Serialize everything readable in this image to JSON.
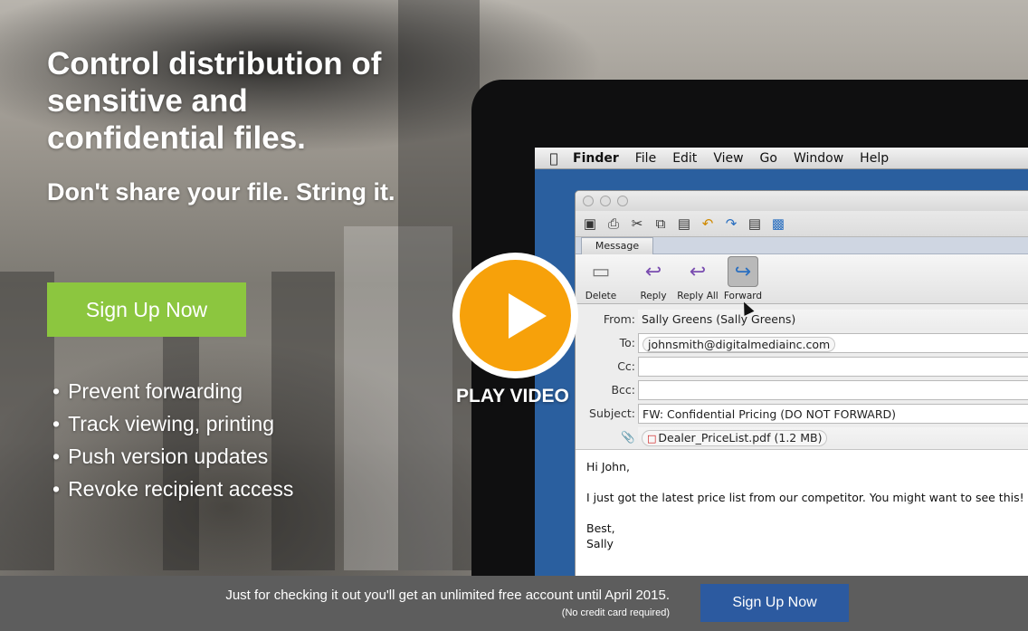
{
  "hero": {
    "headline": "Control distribution of sensitive and confidential files.",
    "subhead": "Don't share your file. String it.",
    "signup_label": "Sign Up Now",
    "features": [
      "Prevent forwarding",
      "Track viewing, printing",
      "Push version updates",
      "Revoke recipient access"
    ]
  },
  "video": {
    "label": "PLAY VIDEO"
  },
  "mac_menu": {
    "apple": "",
    "items": [
      "Finder",
      "File",
      "Edit",
      "View",
      "Go",
      "Window",
      "Help"
    ]
  },
  "mail": {
    "tab": "Message",
    "ribbon": [
      {
        "label": "Delete",
        "icon": "trash-icon"
      },
      {
        "label": "Reply",
        "icon": "reply-icon"
      },
      {
        "label": "Reply All",
        "icon": "reply-all-icon"
      },
      {
        "label": "Forward",
        "icon": "forward-icon"
      }
    ],
    "from_label": "From:",
    "from_value": "Sally Greens (Sally Greens)",
    "to_label": "To:",
    "to_value": "johnsmith@digitalmediainc.com",
    "cc_label": "Cc:",
    "cc_value": "",
    "bcc_label": "Bcc:",
    "bcc_value": "",
    "subject_label": "Subject:",
    "subject_value": "FW: Confidential Pricing (DO NOT FORWARD)",
    "attachment": "Dealer_PriceList.pdf (1.2 MB)",
    "body": {
      "greeting": "Hi John,",
      "line": "I just got the latest price list from our competitor. You might want to see this!",
      "closing": "Best,",
      "signature": "Sally"
    }
  },
  "bottom": {
    "offer": "Just for checking it out you'll get an unlimited free account until April 2015.",
    "note": "(No credit card required)",
    "signup_label": "Sign Up Now"
  }
}
